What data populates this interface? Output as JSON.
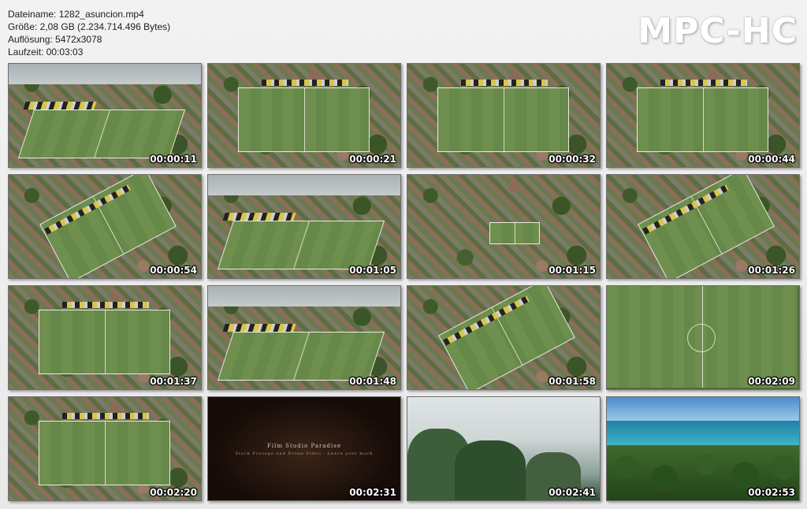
{
  "meta": {
    "filename": "Dateiname: 1282_asuncion.mp4",
    "size": "Größe: 2,08 GB (2.234.714.496 Bytes)",
    "resolution": "Auflösung: 5472x3078",
    "duration": "Laufzeit: 00:03:03"
  },
  "logo": "MPC-HC",
  "thumbnails": [
    {
      "time": "00:00:11",
      "scene": "stadium-oblique-sky"
    },
    {
      "time": "00:00:21",
      "scene": "stadium-top"
    },
    {
      "time": "00:00:32",
      "scene": "stadium-top"
    },
    {
      "time": "00:00:44",
      "scene": "stadium-top"
    },
    {
      "time": "00:00:54",
      "scene": "stadium-diagonal"
    },
    {
      "time": "00:01:05",
      "scene": "stadium-oblique-sky"
    },
    {
      "time": "00:01:15",
      "scene": "town-aerial"
    },
    {
      "time": "00:01:26",
      "scene": "stadium-diagonal"
    },
    {
      "time": "00:01:37",
      "scene": "stadium-top"
    },
    {
      "time": "00:01:48",
      "scene": "stadium-oblique-sky"
    },
    {
      "time": "00:01:58",
      "scene": "stadium-diagonal"
    },
    {
      "time": "00:02:09",
      "scene": "pitch-closeup"
    },
    {
      "time": "00:02:20",
      "scene": "stadium-top"
    },
    {
      "time": "00:02:31",
      "scene": "title-card"
    },
    {
      "time": "00:02:41",
      "scene": "karst-mist"
    },
    {
      "time": "00:02:53",
      "scene": "beach-palms"
    }
  ],
  "title_card": {
    "title": "Film Studio Paradise",
    "subtitle": "Stock Footage and Drone Video · Leave your mark"
  }
}
